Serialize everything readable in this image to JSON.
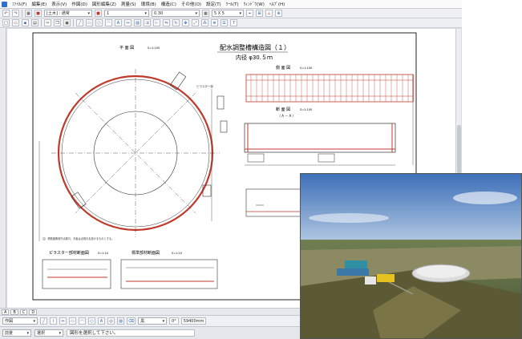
{
  "menu": [
    "ﾌｧｲﾙ(F)",
    "編集(E)",
    "表示(V)",
    "作図(D)",
    "図形編集(Z)",
    "測量(S)",
    "環境(B)",
    "構造(C)",
    "その他(O)",
    "設定(T)",
    "ﾂｰﾙ(T)",
    "ｳｨﾝﾄﾞｳ(W)",
    "ﾍﾙﾌﾟ(H)"
  ],
  "toolbar": {
    "layer_select": "[土木] : 通常",
    "line_select": "1",
    "weight_value": "0.30",
    "grid_value": "5 X 5"
  },
  "drawing": {
    "title": "配水調整槽構造図（１）",
    "subtitle": "内径 φ30.５ｍ",
    "plan_label": "平 面 図",
    "plan_scale": "S=1:100",
    "side_label": "側 面 図",
    "side_scale": "S=1:100",
    "section_label": "断 面 図",
    "section_scale": "S=1:100",
    "section_mark": "（ A － A ）",
    "pilaster_label": "ピラスター部材断面図",
    "pilaster_scale": "S=1:10",
    "standard_label": "標準部材断面図",
    "standard_scale": "S=1:10",
    "callout_1": "ピラスター部",
    "note_text": "注）鉄筋被覆保守点検口、天板は点検孔を設けるものとする。"
  },
  "tabs": [
    "A",
    "B",
    "C",
    "D"
  ],
  "cmd": {
    "mode_select": "作図",
    "color_select": "黒",
    "angle_value": "0°",
    "length_value": "59400mm"
  },
  "status": {
    "layer": "前景",
    "mode": "選択",
    "message": "図形を選択して下さい。"
  }
}
